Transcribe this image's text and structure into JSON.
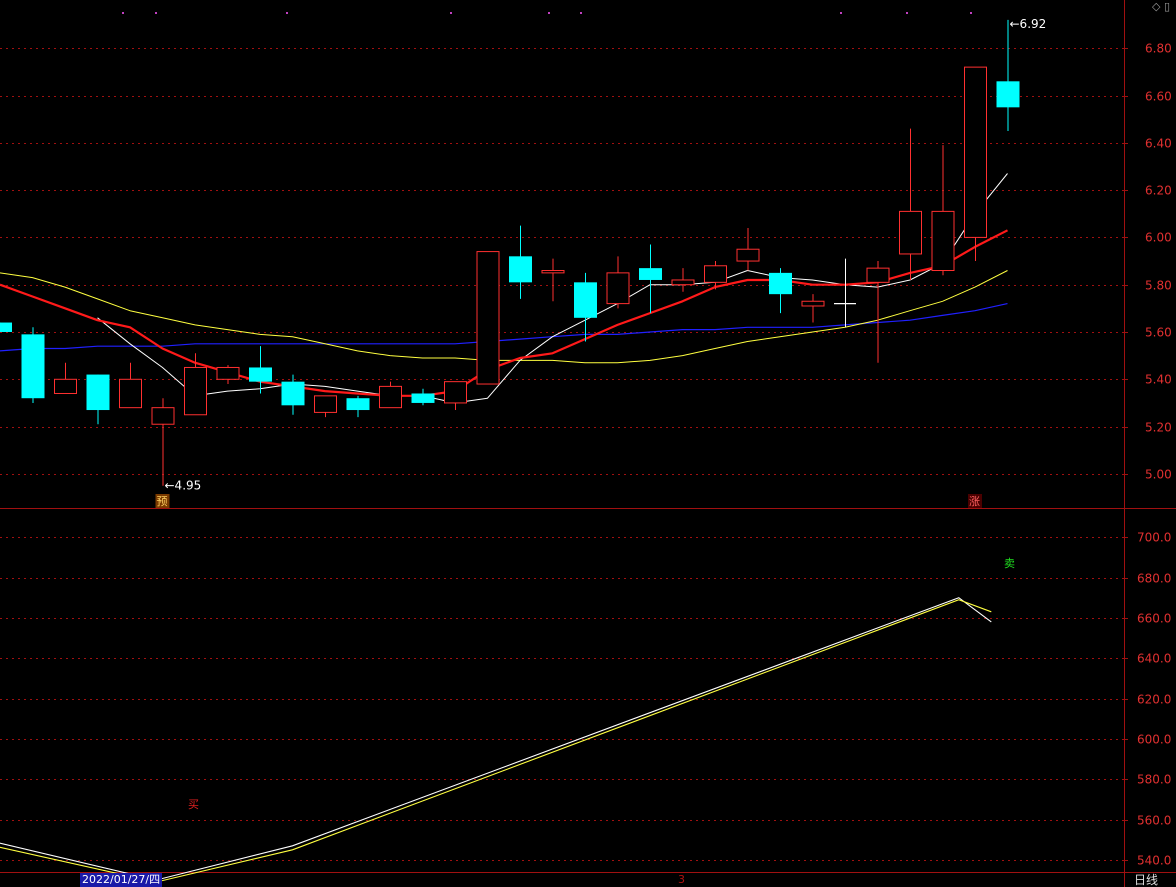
{
  "top_icons": [
    "diamond-icon",
    "window-icon"
  ],
  "bottom_bar": {
    "date": "2022/01/27/四",
    "period": "日线",
    "marker": "3"
  },
  "colors": {
    "up": "#ff3030",
    "down": "#00ffff",
    "ma_white": "#ffffff",
    "ma_red": "#ff1a1a",
    "ma_yellow": "#ffff40",
    "ma_blue": "#2020ff",
    "grid": "#a01010",
    "axis_text": "#e03030"
  },
  "chart_data": [
    {
      "type": "candlestick",
      "y_ticks": [
        "6.80",
        "6.60",
        "6.40",
        "6.20",
        "6.00",
        "5.80",
        "5.60",
        "5.40",
        "5.20",
        "5.00"
      ],
      "ylim": [
        4.86,
        6.97
      ],
      "markers": {
        "low_label": "4.95",
        "high_label": "6.92",
        "pre_label": "预",
        "rise_label": "涨"
      },
      "candles": [
        {
          "o": 5.64,
          "h": 5.64,
          "l": 5.6,
          "c": 5.6
        },
        {
          "o": 5.59,
          "h": 5.62,
          "l": 5.3,
          "c": 5.32
        },
        {
          "o": 5.34,
          "h": 5.47,
          "l": 5.34,
          "c": 5.4
        },
        {
          "o": 5.42,
          "h": 5.42,
          "l": 5.21,
          "c": 5.27
        },
        {
          "o": 5.28,
          "h": 5.47,
          "l": 5.28,
          "c": 5.4
        },
        {
          "o": 5.21,
          "h": 5.32,
          "l": 4.95,
          "c": 5.28
        },
        {
          "o": 5.25,
          "h": 5.51,
          "l": 5.25,
          "c": 5.45
        },
        {
          "o": 5.4,
          "h": 5.46,
          "l": 5.38,
          "c": 5.45
        },
        {
          "o": 5.45,
          "h": 5.54,
          "l": 5.34,
          "c": 5.39
        },
        {
          "o": 5.39,
          "h": 5.42,
          "l": 5.25,
          "c": 5.29
        },
        {
          "o": 5.26,
          "h": 5.33,
          "l": 5.24,
          "c": 5.33
        },
        {
          "o": 5.32,
          "h": 5.33,
          "l": 5.24,
          "c": 5.27
        },
        {
          "o": 5.28,
          "h": 5.39,
          "l": 5.28,
          "c": 5.37
        },
        {
          "o": 5.34,
          "h": 5.36,
          "l": 5.29,
          "c": 5.3
        },
        {
          "o": 5.3,
          "h": 5.39,
          "l": 5.27,
          "c": 5.39
        },
        {
          "o": 5.38,
          "h": 5.94,
          "l": 5.38,
          "c": 5.94
        },
        {
          "o": 5.92,
          "h": 6.05,
          "l": 5.74,
          "c": 5.81
        },
        {
          "o": 5.85,
          "h": 5.91,
          "l": 5.73,
          "c": 5.86
        },
        {
          "o": 5.81,
          "h": 5.85,
          "l": 5.56,
          "c": 5.66
        },
        {
          "o": 5.72,
          "h": 5.92,
          "l": 5.7,
          "c": 5.85
        },
        {
          "o": 5.87,
          "h": 5.97,
          "l": 5.68,
          "c": 5.82
        },
        {
          "o": 5.8,
          "h": 5.87,
          "l": 5.77,
          "c": 5.82
        },
        {
          "o": 5.81,
          "h": 5.9,
          "l": 5.78,
          "c": 5.88
        },
        {
          "o": 5.9,
          "h": 6.04,
          "l": 5.86,
          "c": 5.95
        },
        {
          "o": 5.85,
          "h": 5.87,
          "l": 5.68,
          "c": 5.76
        },
        {
          "o": 5.71,
          "h": 5.76,
          "l": 5.64,
          "c": 5.73
        },
        {
          "o": 5.72,
          "h": 5.91,
          "l": 5.62,
          "c": 5.72
        },
        {
          "o": 5.81,
          "h": 5.9,
          "l": 5.47,
          "c": 5.87
        },
        {
          "o": 5.93,
          "h": 6.46,
          "l": 5.82,
          "c": 6.11
        },
        {
          "o": 5.86,
          "h": 6.39,
          "l": 5.84,
          "c": 6.11
        },
        {
          "o": 6.0,
          "h": 6.72,
          "l": 5.9,
          "c": 6.72
        },
        {
          "o": 6.66,
          "h": 6.92,
          "l": 6.45,
          "c": 6.55
        }
      ],
      "ma_white": [
        null,
        null,
        null,
        5.66,
        5.55,
        5.45,
        5.33,
        5.35,
        5.36,
        5.38,
        5.37,
        5.35,
        5.33,
        5.33,
        5.3,
        5.32,
        5.48,
        5.58,
        5.65,
        5.72,
        5.8,
        5.8,
        5.81,
        5.86,
        5.83,
        5.82,
        5.8,
        5.79,
        5.82,
        5.89,
        6.1,
        6.27
      ],
      "ma_red": [
        5.8,
        5.75,
        5.7,
        5.65,
        5.62,
        5.53,
        5.47,
        5.43,
        5.39,
        5.37,
        5.35,
        5.34,
        5.33,
        5.33,
        5.35,
        5.44,
        5.49,
        5.51,
        5.57,
        5.63,
        5.68,
        5.73,
        5.79,
        5.82,
        5.82,
        5.8,
        5.8,
        5.81,
        5.85,
        5.88,
        5.96,
        6.03
      ],
      "ma_yellow": [
        5.85,
        5.83,
        5.79,
        5.74,
        5.69,
        5.66,
        5.63,
        5.61,
        5.59,
        5.58,
        5.55,
        5.52,
        5.5,
        5.49,
        5.49,
        5.48,
        5.48,
        5.48,
        5.47,
        5.47,
        5.48,
        5.5,
        5.53,
        5.56,
        5.58,
        5.6,
        5.62,
        5.65,
        5.69,
        5.73,
        5.79,
        5.86
      ],
      "ma_blue": [
        5.52,
        5.53,
        5.53,
        5.54,
        5.54,
        5.54,
        5.55,
        5.55,
        5.55,
        5.55,
        5.55,
        5.55,
        5.55,
        5.55,
        5.55,
        5.56,
        5.57,
        5.58,
        5.59,
        5.59,
        5.6,
        5.61,
        5.61,
        5.62,
        5.62,
        5.62,
        5.63,
        5.64,
        5.65,
        5.67,
        5.69,
        5.72
      ]
    },
    {
      "type": "line",
      "y_ticks": [
        "700.0",
        "680.0",
        "660.0",
        "640.0",
        "620.0",
        "600.0",
        "580.0",
        "560.0",
        "540.0"
      ],
      "ylim": [
        533.5,
        713.5
      ],
      "labels": {
        "buy": "买",
        "sell": "卖"
      },
      "series": [
        {
          "color": "#ffffff",
          "points": [
            [
              -0.2,
              549
            ],
            [
              4.8,
              530
            ],
            [
              9,
              547
            ],
            [
              29.5,
              670
            ],
            [
              30.5,
              658
            ]
          ]
        },
        {
          "color": "#ffff40",
          "points": [
            [
              -0.2,
              547
            ],
            [
              4.8,
              529
            ],
            [
              9,
              545
            ],
            [
              29.5,
              669
            ],
            [
              30.5,
              663
            ]
          ]
        }
      ]
    }
  ]
}
